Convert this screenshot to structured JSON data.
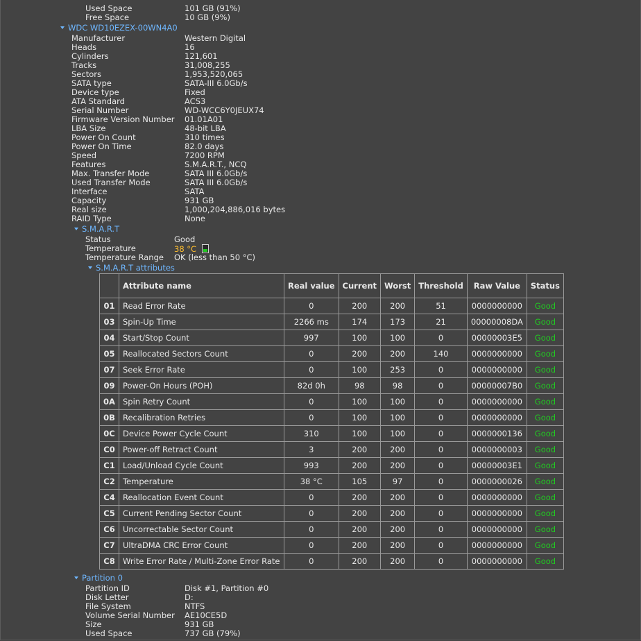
{
  "top_rows": [
    {
      "label": "Used Space",
      "value": "101 GB (91%)"
    },
    {
      "label": "Free Space",
      "value": "10 GB (9%)"
    }
  ],
  "drive": {
    "title": "WDC WD10EZEX-00WN4A0",
    "rows": [
      {
        "label": "Manufacturer",
        "value": "Western Digital"
      },
      {
        "label": "Heads",
        "value": "16"
      },
      {
        "label": "Cylinders",
        "value": "121,601"
      },
      {
        "label": "Tracks",
        "value": "31,008,255"
      },
      {
        "label": "Sectors",
        "value": "1,953,520,065"
      },
      {
        "label": "SATA type",
        "value": "SATA-III 6.0Gb/s"
      },
      {
        "label": "Device type",
        "value": "Fixed"
      },
      {
        "label": "ATA Standard",
        "value": "ACS3"
      },
      {
        "label": "Serial Number",
        "value": "WD-WCC6Y0JEUX74"
      },
      {
        "label": "Firmware Version Number",
        "value": "01.01A01"
      },
      {
        "label": "LBA Size",
        "value": "48-bit LBA"
      },
      {
        "label": "Power On Count",
        "value": "310 times"
      },
      {
        "label": "Power On Time",
        "value": "82.0 days"
      },
      {
        "label": "Speed",
        "value": "7200 RPM"
      },
      {
        "label": "Features",
        "value": "S.M.A.R.T., NCQ"
      },
      {
        "label": "Max. Transfer Mode",
        "value": "SATA III 6.0Gb/s"
      },
      {
        "label": "Used Transfer Mode",
        "value": "SATA III 6.0Gb/s"
      },
      {
        "label": "Interface",
        "value": "SATA"
      },
      {
        "label": "Capacity",
        "value": "931 GB"
      },
      {
        "label": "Real size",
        "value": "1,000,204,886,016 bytes"
      },
      {
        "label": "RAID Type",
        "value": "None"
      }
    ]
  },
  "smart": {
    "title": "S.M.A.R.T",
    "status_label": "Status",
    "status_value": "Good",
    "temp_label": "Temperature",
    "temp_value": "38 °C",
    "temp_indicator_color": "#22c922",
    "range_label": "Temperature Range",
    "range_value": "OK (less than 50 °C)",
    "attributes_title": "S.M.A.R.T attributes"
  },
  "smart_table": {
    "headers": {
      "name": "Attribute name",
      "real": "Real value",
      "current": "Current",
      "worst": "Worst",
      "threshold": "Threshold",
      "raw": "Raw Value",
      "status": "Status"
    },
    "rows": [
      {
        "id": "01",
        "name": "Read Error Rate",
        "real": "0",
        "current": "200",
        "worst": "200",
        "threshold": "51",
        "raw": "0000000000",
        "status": "Good"
      },
      {
        "id": "03",
        "name": "Spin-Up Time",
        "real": "2266 ms",
        "current": "174",
        "worst": "173",
        "threshold": "21",
        "raw": "00000008DA",
        "status": "Good"
      },
      {
        "id": "04",
        "name": "Start/Stop Count",
        "real": "997",
        "current": "100",
        "worst": "100",
        "threshold": "0",
        "raw": "00000003E5",
        "status": "Good"
      },
      {
        "id": "05",
        "name": "Reallocated Sectors Count",
        "real": "0",
        "current": "200",
        "worst": "200",
        "threshold": "140",
        "raw": "0000000000",
        "status": "Good"
      },
      {
        "id": "07",
        "name": "Seek Error Rate",
        "real": "0",
        "current": "100",
        "worst": "253",
        "threshold": "0",
        "raw": "0000000000",
        "status": "Good"
      },
      {
        "id": "09",
        "name": "Power-On Hours (POH)",
        "real": "82d 0h",
        "current": "98",
        "worst": "98",
        "threshold": "0",
        "raw": "00000007B0",
        "status": "Good"
      },
      {
        "id": "0A",
        "name": "Spin Retry Count",
        "real": "0",
        "current": "100",
        "worst": "100",
        "threshold": "0",
        "raw": "0000000000",
        "status": "Good"
      },
      {
        "id": "0B",
        "name": "Recalibration Retries",
        "real": "0",
        "current": "100",
        "worst": "100",
        "threshold": "0",
        "raw": "0000000000",
        "status": "Good"
      },
      {
        "id": "0C",
        "name": "Device Power Cycle Count",
        "real": "310",
        "current": "100",
        "worst": "100",
        "threshold": "0",
        "raw": "0000000136",
        "status": "Good"
      },
      {
        "id": "C0",
        "name": "Power-off Retract Count",
        "real": "3",
        "current": "200",
        "worst": "200",
        "threshold": "0",
        "raw": "0000000003",
        "status": "Good"
      },
      {
        "id": "C1",
        "name": "Load/Unload Cycle Count",
        "real": "993",
        "current": "200",
        "worst": "200",
        "threshold": "0",
        "raw": "00000003E1",
        "status": "Good"
      },
      {
        "id": "C2",
        "name": "Temperature",
        "real": "38 °C",
        "current": "105",
        "worst": "97",
        "threshold": "0",
        "raw": "0000000026",
        "status": "Good"
      },
      {
        "id": "C4",
        "name": "Reallocation Event Count",
        "real": "0",
        "current": "200",
        "worst": "200",
        "threshold": "0",
        "raw": "0000000000",
        "status": "Good"
      },
      {
        "id": "C5",
        "name": "Current Pending Sector Count",
        "real": "0",
        "current": "200",
        "worst": "200",
        "threshold": "0",
        "raw": "0000000000",
        "status": "Good"
      },
      {
        "id": "C6",
        "name": "Uncorrectable Sector Count",
        "real": "0",
        "current": "200",
        "worst": "200",
        "threshold": "0",
        "raw": "0000000000",
        "status": "Good"
      },
      {
        "id": "C7",
        "name": "UltraDMA CRC Error Count",
        "real": "0",
        "current": "200",
        "worst": "200",
        "threshold": "0",
        "raw": "0000000000",
        "status": "Good"
      },
      {
        "id": "C8",
        "name": "Write Error Rate / Multi-Zone Error Rate",
        "real": "0",
        "current": "200",
        "worst": "200",
        "threshold": "0",
        "raw": "0000000000",
        "status": "Good"
      }
    ]
  },
  "partition": {
    "title": "Partition 0",
    "rows": [
      {
        "label": "Partition ID",
        "value": "Disk #1, Partition #0"
      },
      {
        "label": "Disk Letter",
        "value": "D:"
      },
      {
        "label": "File System",
        "value": "NTFS"
      },
      {
        "label": "Volume Serial Number",
        "value": "AE10CE5D"
      },
      {
        "label": "Size",
        "value": "931 GB"
      },
      {
        "label": "Used Space",
        "value": "737 GB (79%)"
      }
    ]
  }
}
